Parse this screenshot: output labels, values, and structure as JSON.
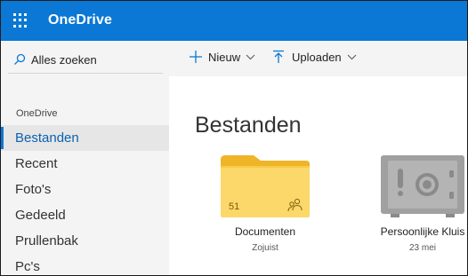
{
  "app": {
    "brand": "OneDrive"
  },
  "sidebar": {
    "search_label": "Alles zoeken",
    "section_label": "OneDrive",
    "items": [
      {
        "label": "Bestanden",
        "active": true
      },
      {
        "label": "Recent"
      },
      {
        "label": "Foto's"
      },
      {
        "label": "Gedeeld"
      },
      {
        "label": "Prullenbak"
      },
      {
        "label": "Pc's"
      }
    ]
  },
  "toolbar": {
    "new_label": "Nieuw",
    "upload_label": "Uploaden"
  },
  "main": {
    "title": "Bestanden",
    "tiles": [
      {
        "name": "Documenten",
        "date": "Zojuist",
        "count": "51",
        "icon": "shared-folder-icon"
      },
      {
        "name": "Persoonlijke Kluis",
        "date": "23 mei",
        "icon": "vault-safe-icon"
      }
    ]
  },
  "colors": {
    "accent": "#0a78d4",
    "folder": "#fcd86b",
    "folder_tab": "#f0b428",
    "vault": "#a0a0a0"
  }
}
